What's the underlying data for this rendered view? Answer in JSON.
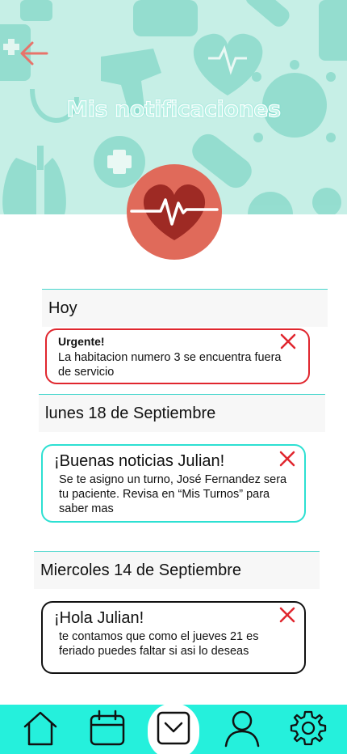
{
  "header": {
    "title": "Mis notificaciones"
  },
  "sections": [
    {
      "heading": "Hoy",
      "notifications": [
        {
          "title": "Urgente!",
          "body": "La habitacion numero 3 se encuentra fuera de servicio",
          "border_color": "#e0262e"
        }
      ]
    },
    {
      "heading": "lunes 18 de Septiembre",
      "notifications": [
        {
          "title": "¡Buenas noticias Julian!",
          "body": "Se  te asigno un turno, José Fernandez sera tu paciente. Revisa en “Mis Turnos” para saber mas",
          "border_color": "#2de0d2"
        }
      ]
    },
    {
      "heading": "Miercoles 14 de Septiembre",
      "notifications": [
        {
          "title": "¡Hola Julian!",
          "body": "te contamos que como el jueves 21 es feriado puedes faltar si asi lo deseas",
          "border_color": "#111111"
        }
      ]
    }
  ],
  "colors": {
    "accent": "#25f0dc",
    "header_bg": "#c6efe6",
    "back_arrow": "#e8736a",
    "close_x": "#e0262e",
    "heart_badge": "#e06a5a"
  },
  "icons": {
    "back": "arrow-left-icon",
    "close": "close-icon",
    "heart": "heart-pulse-icon",
    "nav": [
      "home-icon",
      "calendar-icon",
      "notifications-inbox-icon",
      "profile-icon",
      "settings-icon"
    ]
  },
  "bottom_nav": {
    "active_index": 2
  }
}
